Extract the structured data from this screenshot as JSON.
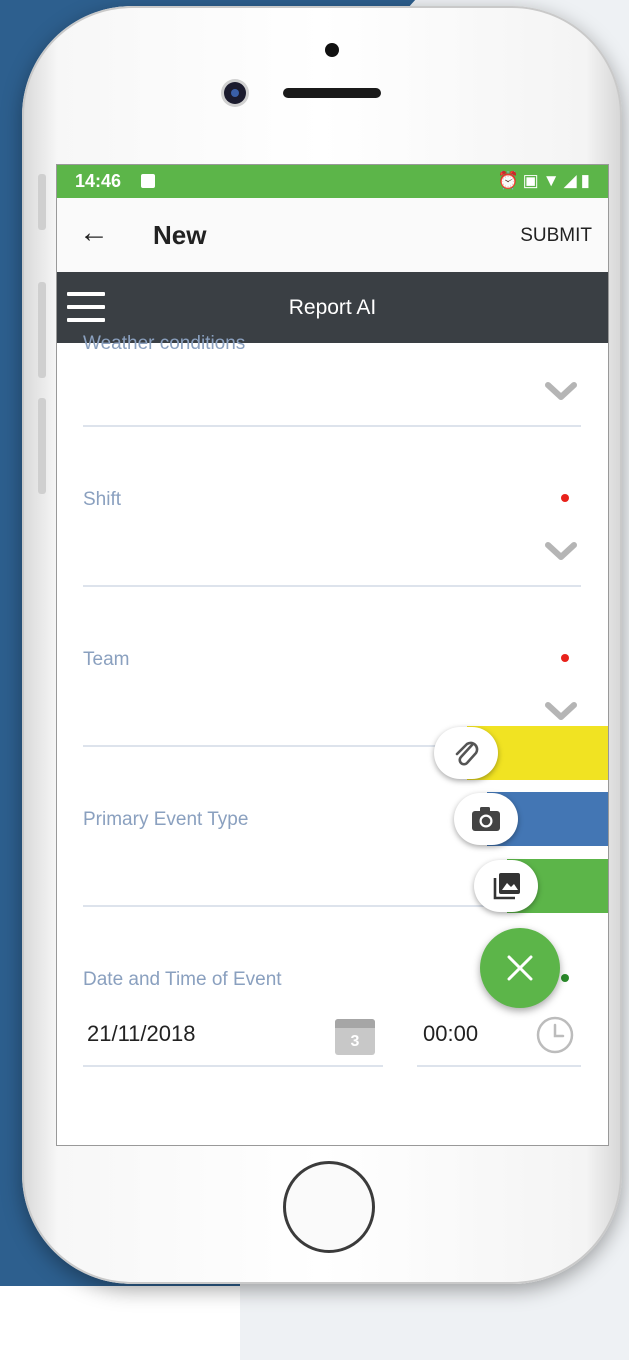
{
  "status_bar": {
    "time": "14:46",
    "right_icons": [
      "alarm-icon",
      "vibrate-icon",
      "wifi-icon",
      "signal-icon",
      "battery-icon"
    ]
  },
  "app_bar": {
    "title": "New",
    "submit_label": "SUBMIT"
  },
  "nav_bar": {
    "title": "Report AI"
  },
  "form": {
    "fields": [
      {
        "label": "Weather conditions",
        "value": "",
        "required": false
      },
      {
        "label": "Shift",
        "value": "",
        "required": true
      },
      {
        "label": "Team",
        "value": "",
        "required": true
      },
      {
        "label": "Primary Event Type",
        "value": "",
        "required": false
      },
      {
        "label": "Date and Time of Event",
        "required": true
      }
    ],
    "date_value": "21/11/2018",
    "calendar_day": "3",
    "time_value": "00:00"
  },
  "fab_menu": {
    "actions": [
      {
        "icon": "paperclip-icon",
        "color": "#f1e322"
      },
      {
        "icon": "camera-icon",
        "color": "#4376b4"
      },
      {
        "icon": "gallery-icon",
        "color": "#5cb549"
      }
    ],
    "close_icon": "close-icon"
  },
  "colors": {
    "status_bar": "#5cb549",
    "nav_bar": "#3a3f44",
    "label": "#8aa0bf",
    "required": "#e8221b"
  }
}
